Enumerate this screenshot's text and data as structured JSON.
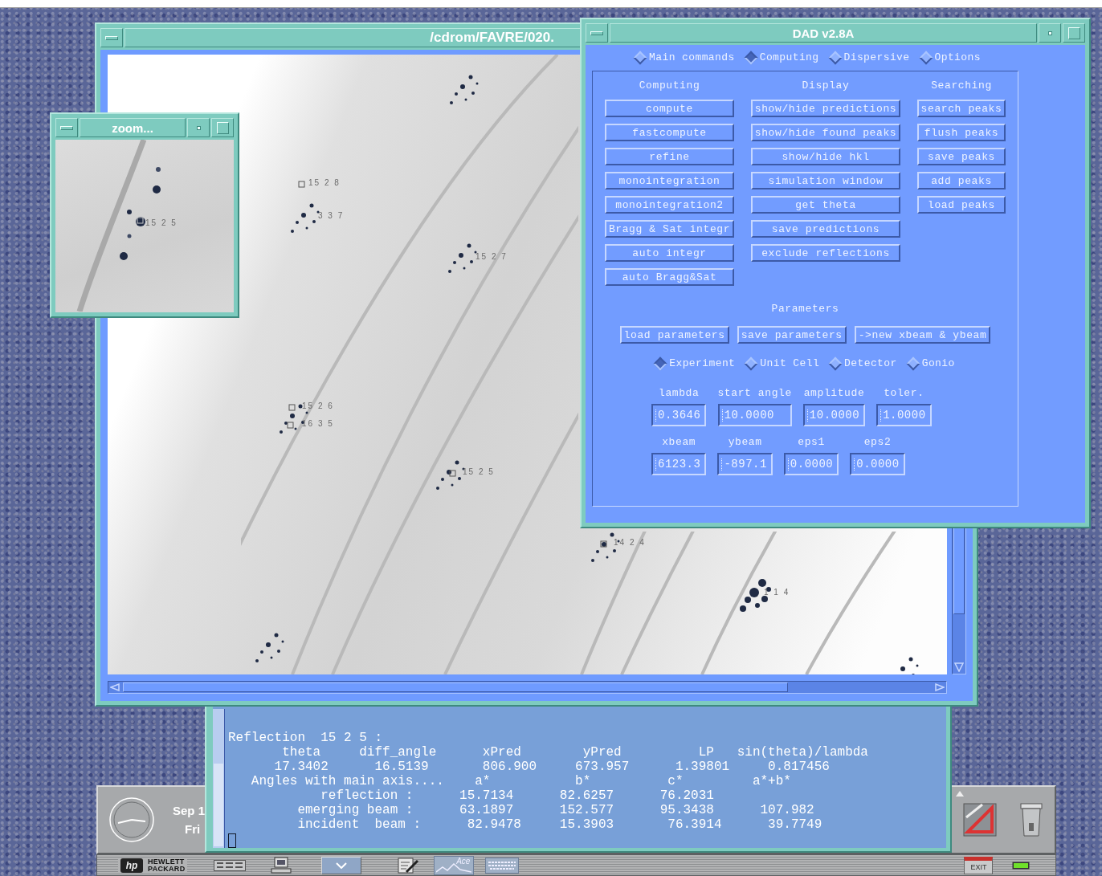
{
  "image_window": {
    "title": "/cdrom/FAVRE/020.",
    "spot_labels": [
      "15 2 8",
      "3 3 7",
      "15 2 7",
      "15 2 6",
      "16 3 5",
      "15 2 5",
      "14 2 4",
      "1 1 4"
    ]
  },
  "zoom_window": {
    "title": "zoom...",
    "spot_labels": [
      "15 2 5"
    ]
  },
  "dad_window": {
    "title": "DAD v2.8A",
    "modes": [
      {
        "label": "Main commands",
        "selected": false
      },
      {
        "label": "Computing",
        "selected": true
      },
      {
        "label": "Dispersive",
        "selected": false
      },
      {
        "label": "Options",
        "selected": false
      }
    ],
    "command_groups": [
      {
        "heading": "Computing",
        "buttons": [
          "compute",
          "fastcompute",
          "refine",
          "monointegration",
          "monointegration2",
          "Bragg & Sat integr",
          "auto integr",
          "auto Bragg&Sat"
        ]
      },
      {
        "heading": "Display",
        "buttons": [
          "show/hide predictions",
          "show/hide found peaks",
          "show/hide hkl",
          "simulation window",
          "get theta",
          "save predictions",
          "exclude reflections"
        ]
      },
      {
        "heading": "Searching",
        "buttons": [
          "search peaks",
          "flush peaks",
          "save peaks",
          "add peaks",
          "load peaks"
        ]
      }
    ],
    "parameters": {
      "heading": "Parameters",
      "buttons": [
        "load parameters",
        "save parameters",
        "->new xbeam & ybeam"
      ],
      "tabs": [
        {
          "label": "Experiment",
          "selected": true
        },
        {
          "label": "Unit Cell",
          "selected": false
        },
        {
          "label": "Detector",
          "selected": false
        },
        {
          "label": "Gonio",
          "selected": false
        }
      ],
      "field_rows": [
        [
          {
            "label": "lambda",
            "value": "0.3646"
          },
          {
            "label": "start angle",
            "value": "10.0000"
          },
          {
            "label": "amplitude",
            "value": "10.0000"
          },
          {
            "label": "toler.",
            "value": "1.0000"
          }
        ],
        [
          {
            "label": "xbeam",
            "value": "6123.3"
          },
          {
            "label": "ybeam",
            "value": "-897.1"
          },
          {
            "label": "eps1",
            "value": "0.0000"
          },
          {
            "label": "eps2",
            "value": "0.0000"
          }
        ]
      ]
    }
  },
  "terminal": {
    "lines": [
      "Reflection  15 2 5 :",
      "       theta     diff_angle      xPred        yPred          LP   sin(theta)/lambda",
      "      17.3402      16.5139       806.900     673.957      1.39801     0.817456",
      "   Angles with main axis....    a*           b*          c*         a*+b*",
      "            reflection :      15.7134      82.6257      76.2031",
      "         emerging beam :      63.1897      152.577      95.3438      107.982",
      "         incident  beam :      82.9478     15.3903       76.3914      39.7749"
    ]
  },
  "front_panel": {
    "date": "Sep 1",
    "weekday": "Fri",
    "logo_mark": "hp",
    "logo_lines": [
      "HEWLETT",
      "PACKARD"
    ],
    "graph_icon_label": "Ace",
    "exit_label": "EXIT"
  }
}
